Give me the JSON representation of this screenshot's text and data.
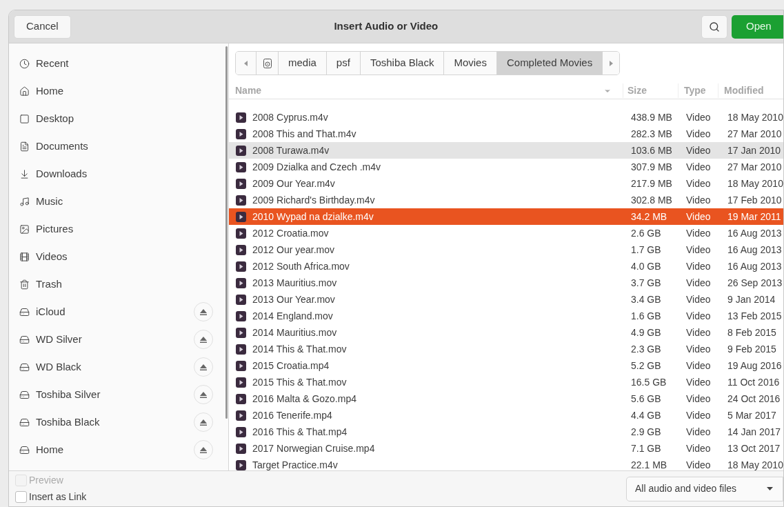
{
  "window": {
    "title": "Insert Audio or Video",
    "cancel": "Cancel",
    "open": "Open"
  },
  "sidebar": {
    "items": [
      {
        "label": "Recent",
        "kind": "recent",
        "eject": false
      },
      {
        "label": "Home",
        "kind": "home",
        "eject": false
      },
      {
        "label": "Desktop",
        "kind": "desktop",
        "eject": false
      },
      {
        "label": "Documents",
        "kind": "documents",
        "eject": false
      },
      {
        "label": "Downloads",
        "kind": "downloads",
        "eject": false
      },
      {
        "label": "Music",
        "kind": "music",
        "eject": false
      },
      {
        "label": "Pictures",
        "kind": "pictures",
        "eject": false
      },
      {
        "label": "Videos",
        "kind": "videos",
        "eject": false
      },
      {
        "label": "Trash",
        "kind": "trash",
        "eject": false
      },
      {
        "label": "iCloud",
        "kind": "drive",
        "eject": true
      },
      {
        "label": "WD Silver",
        "kind": "drive",
        "eject": true
      },
      {
        "label": "WD Black",
        "kind": "drive",
        "eject": true
      },
      {
        "label": "Toshiba Silver",
        "kind": "drive",
        "eject": true
      },
      {
        "label": "Toshiba Black",
        "kind": "drive",
        "eject": true
      },
      {
        "label": "Home",
        "kind": "drive",
        "eject": true
      }
    ]
  },
  "path": [
    {
      "label": "media",
      "selected": false
    },
    {
      "label": "psf",
      "selected": false
    },
    {
      "label": "Toshiba Black",
      "selected": false
    },
    {
      "label": "Movies",
      "selected": false
    },
    {
      "label": "Completed Movies",
      "selected": true
    }
  ],
  "table": {
    "columns": [
      "Name",
      "Size",
      "Type",
      "Modified"
    ],
    "rows": [
      {
        "name": "2008 Cyprus.m4v",
        "size": "438.9 MB",
        "type": "Video",
        "modified": "18 May 2010",
        "selected": false,
        "hovered": false
      },
      {
        "name": "2008 This and That.m4v",
        "size": "282.3 MB",
        "type": "Video",
        "modified": "27 Mar 2010",
        "selected": false,
        "hovered": false
      },
      {
        "name": "2008 Turawa.m4v",
        "size": "103.6 MB",
        "type": "Video",
        "modified": "17 Jan 2010",
        "selected": false,
        "hovered": true
      },
      {
        "name": "2009 Dzialka and Czech .m4v",
        "size": "307.9 MB",
        "type": "Video",
        "modified": "27 Mar 2010",
        "selected": false,
        "hovered": false
      },
      {
        "name": "2009 Our Year.m4v",
        "size": "217.9 MB",
        "type": "Video",
        "modified": "18 May 2010",
        "selected": false,
        "hovered": false
      },
      {
        "name": "2009 Richard's Birthday.m4v",
        "size": "302.8 MB",
        "type": "Video",
        "modified": "17 Feb 2010",
        "selected": false,
        "hovered": false
      },
      {
        "name": "2010 Wypad na dzialke.m4v",
        "size": "34.2 MB",
        "type": "Video",
        "modified": "19 Mar 2011",
        "selected": true,
        "hovered": false
      },
      {
        "name": "2012 Croatia.mov",
        "size": "2.6 GB",
        "type": "Video",
        "modified": "16 Aug 2013",
        "selected": false,
        "hovered": false
      },
      {
        "name": "2012 Our year.mov",
        "size": "1.7 GB",
        "type": "Video",
        "modified": "16 Aug 2013",
        "selected": false,
        "hovered": false
      },
      {
        "name": "2012 South Africa.mov",
        "size": "4.0 GB",
        "type": "Video",
        "modified": "16 Aug 2013",
        "selected": false,
        "hovered": false
      },
      {
        "name": "2013 Mauritius.mov",
        "size": "3.7 GB",
        "type": "Video",
        "modified": "26 Sep 2013",
        "selected": false,
        "hovered": false
      },
      {
        "name": "2013 Our Year.mov",
        "size": "3.4 GB",
        "type": "Video",
        "modified": "9 Jan 2014",
        "selected": false,
        "hovered": false
      },
      {
        "name": "2014 England.mov",
        "size": "1.6 GB",
        "type": "Video",
        "modified": "13 Feb 2015",
        "selected": false,
        "hovered": false
      },
      {
        "name": "2014 Mauritius.mov",
        "size": "4.9 GB",
        "type": "Video",
        "modified": "8 Feb 2015",
        "selected": false,
        "hovered": false
      },
      {
        "name": "2014 This & That.mov",
        "size": "2.3 GB",
        "type": "Video",
        "modified": "9 Feb 2015",
        "selected": false,
        "hovered": false
      },
      {
        "name": "2015 Croatia.mp4",
        "size": "5.2 GB",
        "type": "Video",
        "modified": "19 Aug 2016",
        "selected": false,
        "hovered": false
      },
      {
        "name": "2015 This & That.mov",
        "size": "16.5 GB",
        "type": "Video",
        "modified": "11 Oct 2016",
        "selected": false,
        "hovered": false
      },
      {
        "name": "2016 Malta & Gozo.mp4",
        "size": "5.6 GB",
        "type": "Video",
        "modified": "24 Oct 2016",
        "selected": false,
        "hovered": false
      },
      {
        "name": "2016 Tenerife.mp4",
        "size": "4.4 GB",
        "type": "Video",
        "modified": "5 Mar 2017",
        "selected": false,
        "hovered": false
      },
      {
        "name": "2016 This & That.mp4",
        "size": "2.9 GB",
        "type": "Video",
        "modified": "14 Jan 2017",
        "selected": false,
        "hovered": false
      },
      {
        "name": "2017 Norwegian Cruise.mp4",
        "size": "7.1 GB",
        "type": "Video",
        "modified": "13 Oct 2017",
        "selected": false,
        "hovered": false
      },
      {
        "name": "Target Practice.m4v",
        "size": "22.1 MB",
        "type": "Video",
        "modified": "18 May 2010",
        "selected": false,
        "hovered": false
      }
    ]
  },
  "options": [
    {
      "label": "Preview",
      "checked": false,
      "disabled": true
    },
    {
      "label": "Insert as Link",
      "checked": false,
      "disabled": false
    }
  ],
  "filter": {
    "value": "All audio and video files"
  }
}
